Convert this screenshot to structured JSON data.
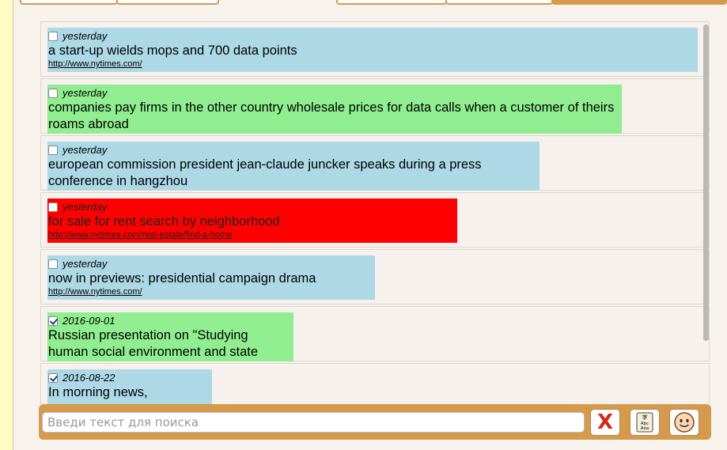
{
  "items": [
    {
      "date": "yesterday",
      "title": "a start-up wields mops and 700 data points",
      "url": "http://www.nytimes.com/",
      "color": "#add8e6",
      "checked": false
    },
    {
      "date": "yesterday",
      "title": "companies pay firms in the other country wholesale prices for data calls when a customer of theirs roams abroad",
      "url": "",
      "color": "#90ee90",
      "checked": false
    },
    {
      "date": "yesterday",
      "title": "european commission president jean-claude juncker speaks during a press conference in hangzhou",
      "url": "",
      "color": "#add8e6",
      "checked": false
    },
    {
      "date": "yesterday",
      "title": "for sale for rent search by neighborhood",
      "url": "http://www.nytimes.com/real-estate/find-a-home",
      "color": "#ff0000",
      "checked": false
    },
    {
      "date": "yesterday",
      "title": "now in previews: presidential campaign drama",
      "url": "http://www.nytimes.com/",
      "color": "#add8e6",
      "checked": false
    },
    {
      "date": "2016-09-01",
      "title": "Russian presentation on \"Studying human social environment and state",
      "url": "",
      "color": "#90ee90",
      "checked": true
    },
    {
      "date": "2016-08-22",
      "title": "In morning news,",
      "url": "",
      "color": "#add8e6",
      "checked": true
    }
  ],
  "search": {
    "placeholder": "Введи текст для поиска",
    "value": ""
  },
  "buttons": {
    "clear": {
      "label": "X",
      "icon": "red-x-icon"
    },
    "dictionary": {
      "icon": "dictionary-icon",
      "text_top": "字",
      "text_mid": "Abc",
      "text_bot": "Aõa"
    },
    "face": {
      "icon": "smiley-face-icon"
    }
  },
  "colors": {
    "accent": "#d59a4c",
    "page_bg": "#fdfdc8",
    "panel_bg": "#f7f3ec",
    "blue": "#add8e6",
    "green": "#90ee90",
    "red": "#ff0000"
  }
}
